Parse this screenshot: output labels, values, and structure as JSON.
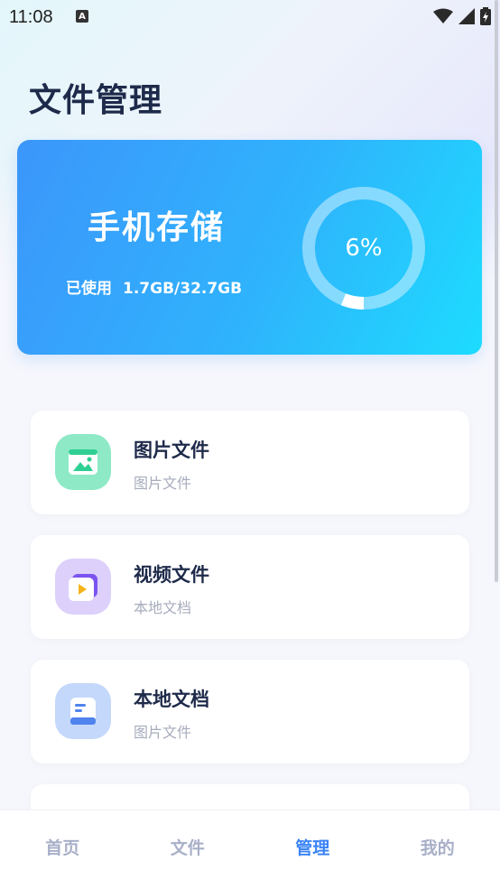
{
  "status_bar": {
    "time": "11:08",
    "notification_letter": "A",
    "icons": [
      "wifi-icon",
      "signal-icon",
      "battery-icon"
    ]
  },
  "page": {
    "title": "文件管理"
  },
  "storage": {
    "title": "手机存储",
    "used_label": "已使用",
    "used_value": "1.7GB/32.7GB",
    "percent_text": "6%",
    "percent": 0.06
  },
  "items": [
    {
      "title": "图片文件",
      "subtitle": "图片文件",
      "icon": "image-icon",
      "color": "#8ee9c6",
      "accent": "#2fcf93"
    },
    {
      "title": "视频文件",
      "subtitle": "本地文档",
      "icon": "video-icon",
      "color": "#ddd0fb",
      "accent": "#7b54f0"
    },
    {
      "title": "本地文档",
      "subtitle": "图片文件",
      "icon": "document-icon",
      "color": "#c4d8fb",
      "accent": "#4f83ee"
    }
  ],
  "nav": {
    "home": "首页",
    "files": "文件",
    "manage": "管理",
    "mine": "我的"
  },
  "colors": {
    "accent": "#3b84f5",
    "card_gradient_start": "#3c96fb",
    "card_gradient_end": "#1ddcfe"
  }
}
